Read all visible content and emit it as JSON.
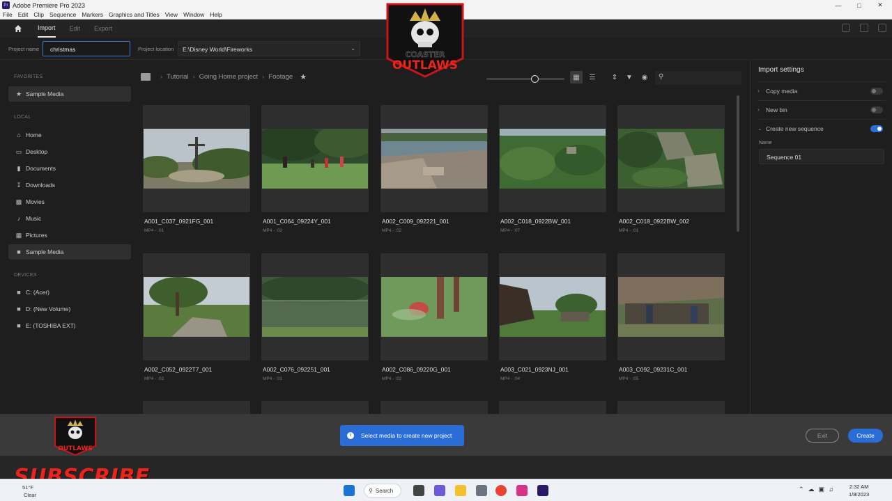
{
  "window": {
    "title": "Adobe Premiere Pro 2023",
    "app_badge": "Pr"
  },
  "menu": [
    "File",
    "Edit",
    "Clip",
    "Sequence",
    "Markers",
    "Graphics and Titles",
    "View",
    "Window",
    "Help"
  ],
  "header_tabs": {
    "import": "Import",
    "edit": "Edit",
    "export": "Export"
  },
  "project": {
    "name_label": "Project name",
    "name_value": "christmas",
    "location_label": "Project location",
    "location_value": "E:\\Disney World\\Fireworks"
  },
  "sidebar": {
    "favorites_header": "FAVORITES",
    "favorites": [
      "Sample Media"
    ],
    "local_header": "LOCAL",
    "local": [
      "Home",
      "Desktop",
      "Documents",
      "Downloads",
      "Movies",
      "Music",
      "Pictures",
      "Sample Media"
    ],
    "devices_header": "DEVICES",
    "devices": [
      "C: (Acer)",
      "D: (New Volume)",
      "E: (TOSHIBA EXT)"
    ]
  },
  "breadcrumb": [
    "Tutorial",
    "Going Home project",
    "Footage"
  ],
  "media": [
    {
      "name": "A001_C037_0921FG_001",
      "meta": "MP4 - :01"
    },
    {
      "name": "A001_C064_09224Y_001",
      "meta": "MP4 - :02"
    },
    {
      "name": "A002_C009_092221_001",
      "meta": "MP4 - :02"
    },
    {
      "name": "A002_C018_0922BW_001",
      "meta": "MP4 - :07"
    },
    {
      "name": "A002_C018_0922BW_002",
      "meta": "MP4 - :01"
    },
    {
      "name": "A002_C052_0922T7_001",
      "meta": "MP4 - :02"
    },
    {
      "name": "A002_C076_092251_001",
      "meta": "MP4 - :01"
    },
    {
      "name": "A002_C086_09220G_001",
      "meta": "MP4 - :02"
    },
    {
      "name": "A003_C021_0923NJ_001",
      "meta": "MP4 - :04"
    },
    {
      "name": "A003_C092_09231C_001",
      "meta": "MP4 - :05"
    }
  ],
  "import_settings": {
    "title": "Import settings",
    "copy_media": "Copy media",
    "copy_media_on": false,
    "new_bin": "New bin",
    "new_bin_on": false,
    "create_sequence": "Create new sequence",
    "create_sequence_on": true,
    "name_label": "Name",
    "name_value": "Sequence 01"
  },
  "bottom": {
    "toast": "Select media to create new project",
    "exit": "Exit",
    "create": "Create"
  },
  "overlay": {
    "subscribe": "SUBSCRIBE",
    "logo_line1": "COASTER",
    "logo_line2": "OUTLAWS"
  },
  "taskbar": {
    "weather_temp": "51°F",
    "weather_desc": "Clear",
    "search": "Search",
    "time": "2:32 AM",
    "date": "1/8/2023"
  },
  "colors": {
    "accent": "#2a6dd6",
    "logo_red": "#c8141a",
    "subscribe_red": "#e8251c"
  }
}
